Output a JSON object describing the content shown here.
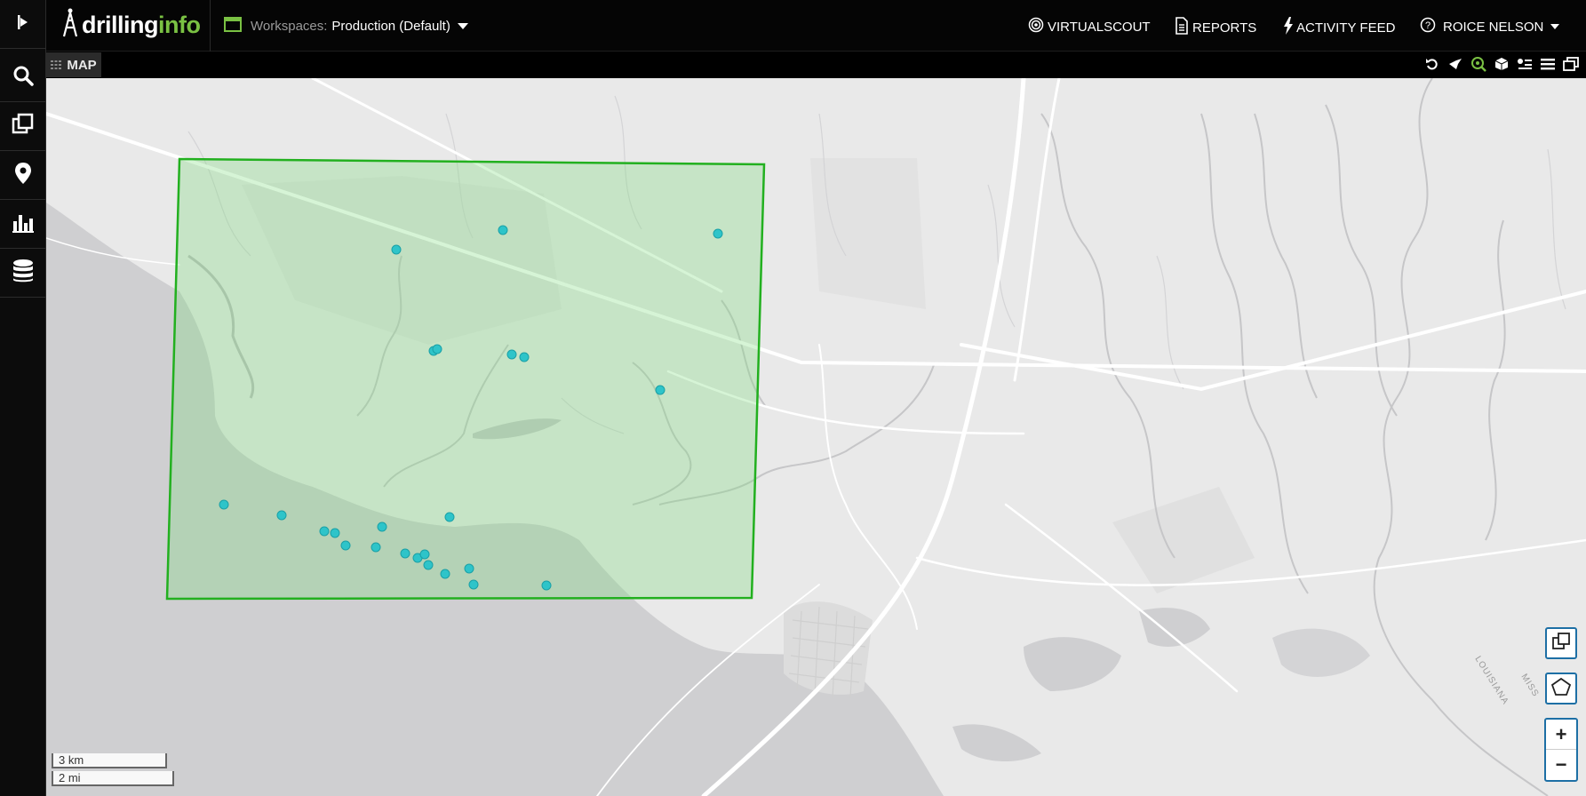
{
  "app": {
    "logo_part1": "drilling",
    "logo_part2": "info",
    "brand_color": "#7ac143"
  },
  "workspace": {
    "label": "Workspaces:",
    "value": "Production (Default)"
  },
  "nav": {
    "virtualscout": "VIRTUALSCOUT",
    "reports": "REPORTS",
    "activity_feed": "ACTIVITY FEED",
    "user": "ROICE NELSON"
  },
  "sidebar": {
    "items": [
      "arrow-flag-icon",
      "search-icon",
      "layers-icon",
      "map-pin-icon",
      "bar-chart-icon",
      "database-icon"
    ]
  },
  "map": {
    "tab_label": "MAP",
    "toolbar_icons": [
      "undo-icon",
      "pin-tool-icon",
      "zoom-to-icon",
      "box-icon",
      "legend-icon",
      "list-icon",
      "window-icon"
    ],
    "polygon_color": "#22b01f",
    "polygon_fill": "rgba(120,220,120,0.3)",
    "well_color": "#2ec4c9",
    "well_count": 25,
    "scale_km": "3 km",
    "scale_mi": "2 mi",
    "label_louisiana": "LOUISIANA",
    "label_miss": "MISS",
    "zoom_in": "+",
    "zoom_out": "−"
  }
}
